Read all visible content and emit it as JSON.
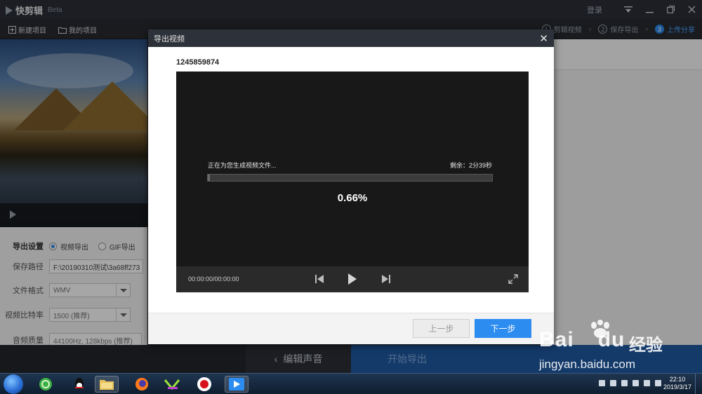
{
  "app": {
    "name": "快剪辑",
    "beta": "Beta",
    "login": "登录"
  },
  "toolbar": {
    "new_project": "新建项目",
    "my_projects": "我的项目"
  },
  "steps": [
    {
      "num": "1",
      "label": "剪辑视频"
    },
    {
      "num": "2",
      "label": "保存导出"
    },
    {
      "num": "3",
      "label": "上传分享"
    }
  ],
  "settings": {
    "export_label": "导出设置",
    "video_export": "视频导出",
    "gif_export": "GIF导出",
    "save_path_label": "保存路径",
    "save_path_value": "F:\\20190310测试\\3a68ff273",
    "format_label": "文件格式",
    "format_value": "WMV",
    "bitrate_label": "视频比特率",
    "bitrate_value": "1500 (推荐)",
    "audio_label": "音频质量",
    "audio_value": "44100Hz, 128kbps (推荐)"
  },
  "bottom": {
    "edit_sound": "编辑声音",
    "start_export": "开始导出"
  },
  "modal": {
    "title": "导出视频",
    "video_name": "1245859874",
    "progress_text": "正在为您生成视频文件...",
    "remaining": "剩余：2分39秒",
    "percent": "0.66%",
    "progress": 0.0066,
    "time": "00:00:00/00:00:00",
    "prev_button": "上一步",
    "next_button": "下一步"
  },
  "taskbar": {
    "time": "22:10",
    "date": "2019/3/17"
  },
  "watermark": {
    "logo": "Bai",
    "logo_end": "du",
    "cn": "经验",
    "url": "jingyan.baidu.com"
  },
  "colors": {
    "accent": "#2d8cf0",
    "dark_bg": "#2b2f36",
    "export_bar": "#1f5aa3"
  }
}
